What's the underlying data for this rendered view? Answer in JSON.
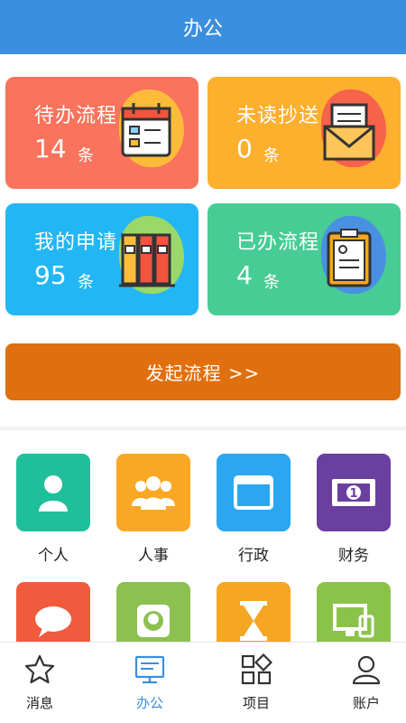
{
  "header": {
    "title": "办公"
  },
  "cards": [
    {
      "label": "待办流程",
      "count": "14",
      "unit": "条",
      "icon": "calendar-icon",
      "color": "#f9735d"
    },
    {
      "label": "未读抄送",
      "count": "0",
      "unit": "条",
      "icon": "mail-icon",
      "color": "#fdaf2e"
    },
    {
      "label": "我的申请",
      "count": "95",
      "unit": "条",
      "icon": "binders-icon",
      "color": "#23b6f4"
    },
    {
      "label": "已办流程",
      "count": "4",
      "unit": "条",
      "icon": "clipboard-icon",
      "color": "#47cc95"
    }
  ],
  "launch_button": {
    "label": "发起流程 >>"
  },
  "grid": [
    {
      "label": "个人",
      "icon": "person-icon",
      "color": "#1fbf9b"
    },
    {
      "label": "人事",
      "icon": "group-icon",
      "color": "#f9a825"
    },
    {
      "label": "行政",
      "icon": "window-icon",
      "color": "#2aa7f0"
    },
    {
      "label": "财务",
      "icon": "banknote-icon",
      "color": "#6a3fa0"
    },
    {
      "label": "",
      "icon": "chat-icon",
      "color": "#f05a3d"
    },
    {
      "label": "",
      "icon": "github-icon",
      "color": "#8cc152"
    },
    {
      "label": "",
      "icon": "hourglass-icon",
      "color": "#f5a623"
    },
    {
      "label": "",
      "icon": "monitor-icon",
      "color": "#8bc34a"
    }
  ],
  "tabbar": [
    {
      "label": "消息",
      "icon": "star-icon",
      "active": false
    },
    {
      "label": "办公",
      "icon": "desktop-icon",
      "active": true
    },
    {
      "label": "项目",
      "icon": "apps-icon",
      "active": false
    },
    {
      "label": "账户",
      "icon": "user-icon",
      "active": false
    }
  ]
}
